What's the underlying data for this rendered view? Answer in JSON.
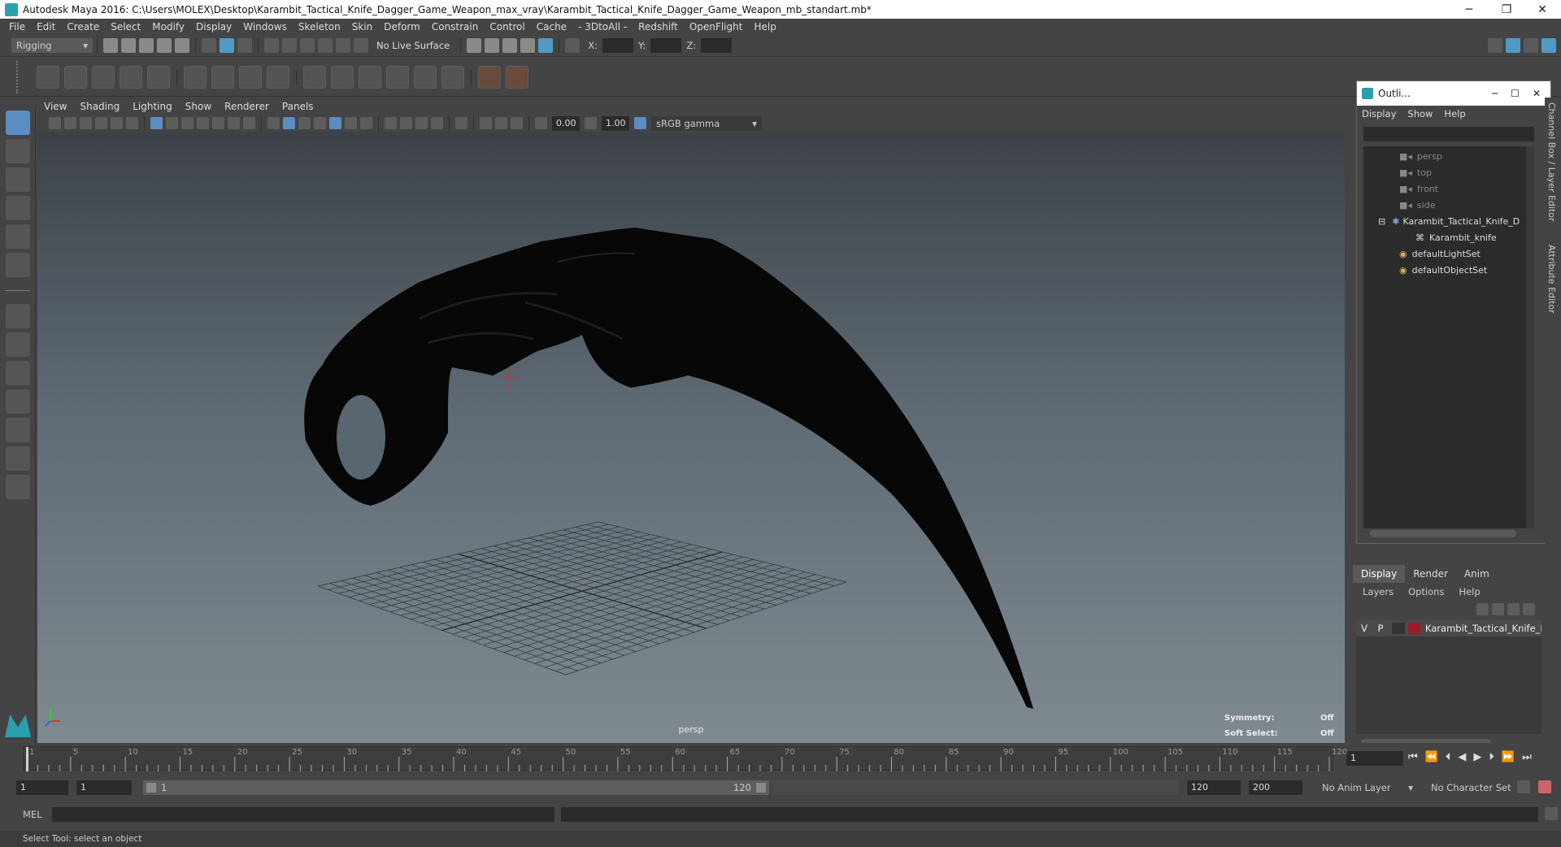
{
  "window": {
    "title": "Autodesk Maya 2016: C:\\Users\\MOLEX\\Desktop\\Karambit_Tactical_Knife_Dagger_Game_Weapon_max_vray\\Karambit_Tactical_Knife_Dagger_Game_Weapon_mb_standart.mb*",
    "minimize": "─",
    "restore": "❐",
    "close": "✕"
  },
  "menubar": [
    "File",
    "Edit",
    "Create",
    "Select",
    "Modify",
    "Display",
    "Windows",
    "Skeleton",
    "Skin",
    "Deform",
    "Constrain",
    "Control",
    "Cache",
    "- 3DtoAll -",
    "Redshift",
    "OpenFlight",
    "Help"
  ],
  "statusline": {
    "mode": "Rigging",
    "live_surface": "No Live Surface",
    "x_label": "X:",
    "y_label": "Y:",
    "z_label": "Z:"
  },
  "viewport": {
    "menu": [
      "View",
      "Shading",
      "Lighting",
      "Show",
      "Renderer",
      "Panels"
    ],
    "exposure": "0.00",
    "gamma": "1.00",
    "color_space": "sRGB gamma",
    "camera_label": "persp",
    "symmetry_label": "Symmetry:",
    "symmetry_value": "Off",
    "soft_select_label": "Soft Select:",
    "soft_select_value": "Off"
  },
  "outliner": {
    "title": "Outli...",
    "menu": [
      "Display",
      "Show",
      "Help"
    ],
    "items": [
      "persp",
      "top",
      "front",
      "side",
      "Karambit_Tactical_Knife_D",
      "Karambit_knife",
      "defaultLightSet",
      "defaultObjectSet"
    ]
  },
  "sidetabs": [
    "Channel Box / Layer Editor",
    "Attribute Editor"
  ],
  "layers": {
    "tabs": [
      "Display",
      "Render",
      "Anim"
    ],
    "menu": [
      "Layers",
      "Options",
      "Help"
    ],
    "visible": "V",
    "playback": "P",
    "layer_name": "Karambit_Tactical_Knife_Da",
    "layer_color": "#9c1a2a"
  },
  "timeline": {
    "ticks": [
      "1",
      "5",
      "10",
      "15",
      "20",
      "25",
      "30",
      "35",
      "40",
      "45",
      "50",
      "55",
      "60",
      "65",
      "70",
      "75",
      "80",
      "85",
      "90",
      "95",
      "100",
      "105",
      "110",
      "115",
      "120"
    ],
    "current_frame": "1"
  },
  "range": {
    "start": "1",
    "playback_start": "1",
    "slider_start": "1",
    "slider_end": "120",
    "playback_end": "120",
    "end": "200",
    "anim_layer": "No Anim Layer",
    "character_set": "No Character Set"
  },
  "cmdline": {
    "label": "MEL"
  },
  "helpline": {
    "text": "Select Tool: select an object"
  },
  "colors": {
    "accent": "#5a8dc2",
    "background": "#444444"
  }
}
